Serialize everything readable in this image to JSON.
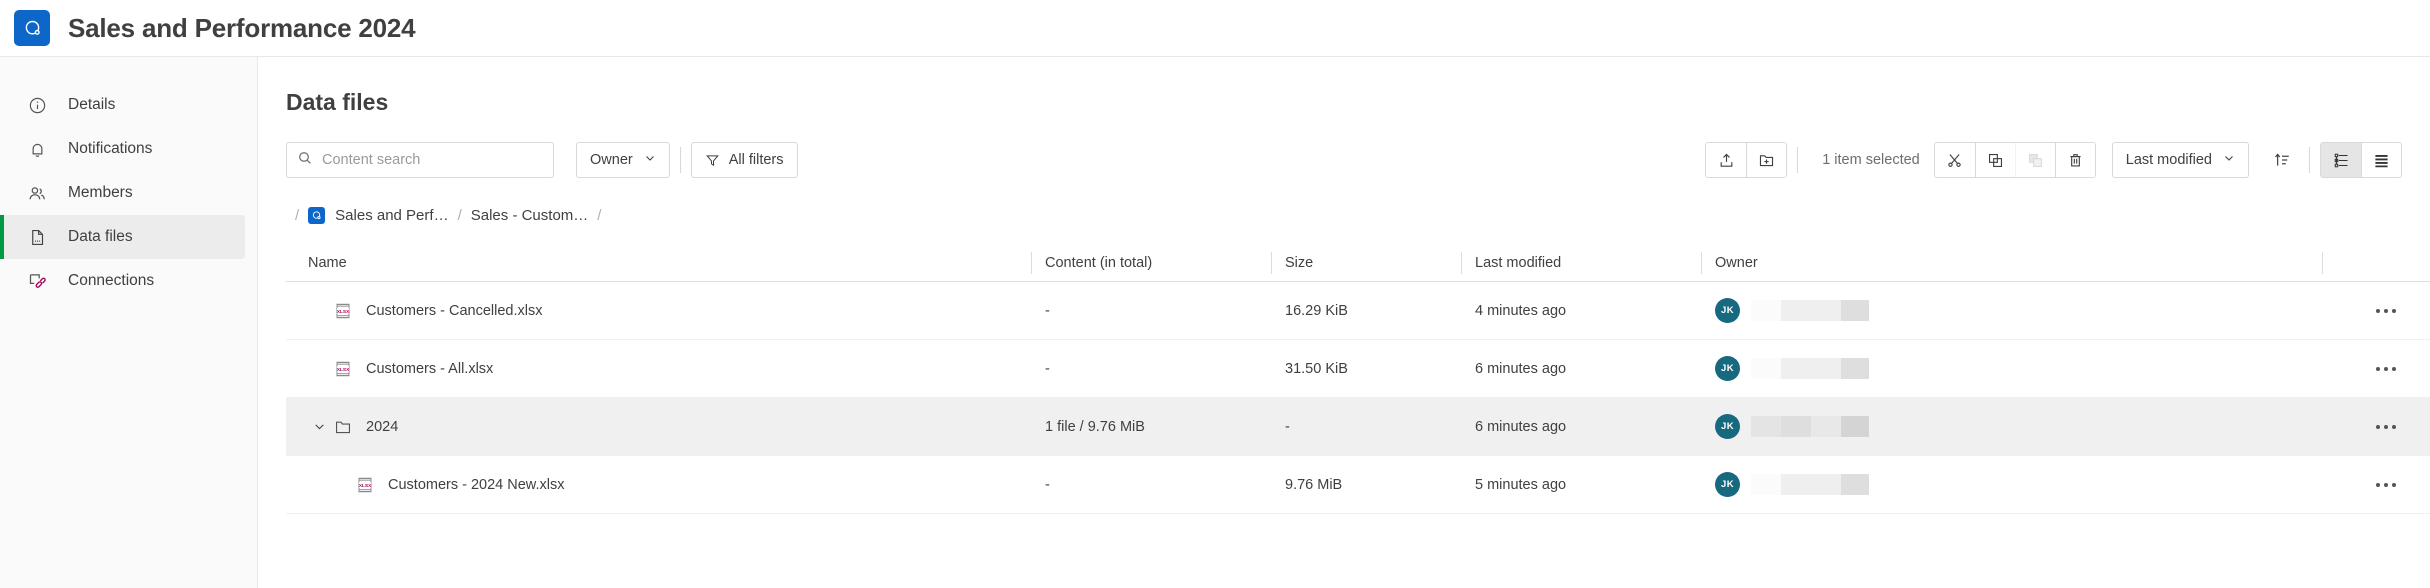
{
  "header": {
    "app_title": "Sales and Performance 2024",
    "logo_icon": "qlik-logo-icon",
    "logo_color": "#0d67c9"
  },
  "sidebar": {
    "items": [
      {
        "label": "Details",
        "icon": "info-circle-icon",
        "active": false
      },
      {
        "label": "Notifications",
        "icon": "bell-icon",
        "active": false
      },
      {
        "label": "Members",
        "icon": "people-icon",
        "active": false
      },
      {
        "label": "Data files",
        "icon": "file-icon",
        "active": true
      },
      {
        "label": "Connections",
        "icon": "connections-icon",
        "active": false
      }
    ],
    "active_accent": "#009845"
  },
  "main": {
    "page_title": "Data files",
    "toolbar": {
      "search_placeholder": "Content search",
      "search_value": "",
      "search_icon": "search-icon",
      "owner_label": "Owner",
      "owner_chevron": "chevron-down-icon",
      "all_filters_label": "All filters",
      "filter_icon": "funnel-icon",
      "upload_icon": "upload-icon",
      "new_folder_icon": "new-folder-icon",
      "selection_label": "1 item selected",
      "cut_icon": "scissors-icon",
      "copy_icon": "copy-icon",
      "paste_icon": "paste-icon",
      "delete_icon": "trash-icon",
      "sort_label": "Last modified",
      "sort_chevron": "chevron-down-icon",
      "sort_direction_icon": "sort-ascending-icon",
      "tree_view_icon": "tree-view-icon",
      "list_view_icon": "list-view-icon",
      "active_view": "tree"
    },
    "breadcrumb": {
      "leading_slash": "/",
      "separator": "/",
      "trailing_slash": "/",
      "items": [
        {
          "label": "Sales and Perf…",
          "has_logo": true
        },
        {
          "label": "Sales - Custom…",
          "has_logo": false
        }
      ]
    },
    "table": {
      "columns": [
        {
          "key": "name",
          "label": "Name"
        },
        {
          "key": "content",
          "label": "Content (in total)"
        },
        {
          "key": "size",
          "label": "Size"
        },
        {
          "key": "modified",
          "label": "Last modified"
        },
        {
          "key": "owner",
          "label": "Owner"
        }
      ],
      "rows": [
        {
          "name": "Customers - Cancelled.xlsx",
          "icon": "xlsx-file-icon",
          "type": "file",
          "indent": 1,
          "content": "-",
          "size": "16.29 KiB",
          "modified": "4 minutes ago",
          "owner_initials": "JK",
          "selected": false,
          "menu_icon": "more-options-icon"
        },
        {
          "name": "Customers - All.xlsx",
          "icon": "xlsx-file-icon",
          "type": "file",
          "indent": 1,
          "content": "-",
          "size": "31.50 KiB",
          "modified": "6 minutes ago",
          "owner_initials": "JK",
          "selected": false,
          "menu_icon": "more-options-icon"
        },
        {
          "name": "2024",
          "icon": "folder-icon",
          "type": "folder",
          "indent": 0,
          "expander": "chevron-down-icon",
          "content": "1 file / 9.76 MiB",
          "size": "-",
          "modified": "6 minutes ago",
          "owner_initials": "JK",
          "selected": true,
          "menu_icon": "more-options-icon"
        },
        {
          "name": "Customers - 2024 New.xlsx",
          "icon": "xlsx-file-icon",
          "type": "file",
          "indent": 2,
          "content": "-",
          "size": "9.76 MiB",
          "modified": "5 minutes ago",
          "owner_initials": "JK",
          "selected": false,
          "menu_icon": "more-options-icon"
        }
      ]
    }
  },
  "colors": {
    "brand_blue": "#0d67c9",
    "accent_green": "#009845",
    "avatar_teal": "#16697f",
    "xlsx_magenta": "#a4005a",
    "row_selected": "#f0f0f0"
  }
}
